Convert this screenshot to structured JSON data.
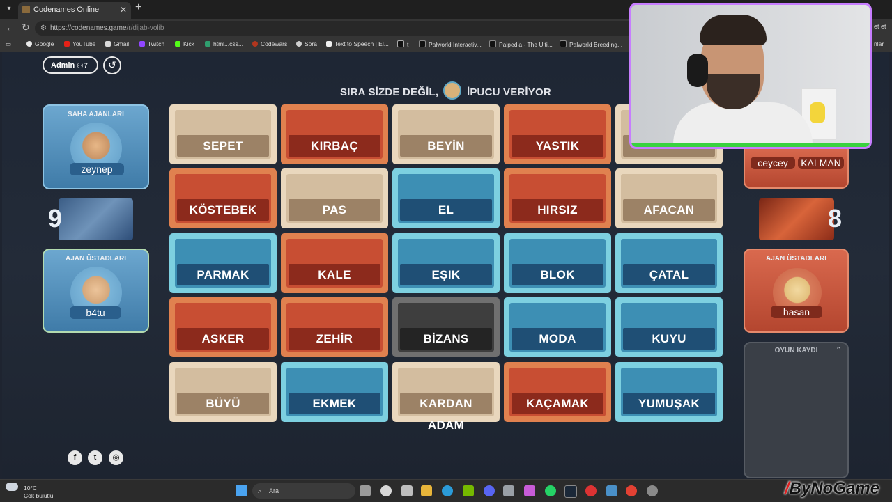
{
  "browser": {
    "tab_title": "Codenames Online",
    "url_prefix": "https://codenames.game",
    "url_path": "/r/dijab-volib",
    "addr_right": "et et",
    "bookmarks": [
      "Google",
      "YouTube",
      "Gmail",
      "Twitch",
      "Kick",
      "html...css...",
      "Codewars",
      "Sora",
      "Text to Speech | El...",
      "t",
      "Palworld Interactiv...",
      "Palpedia - The Ulti...",
      "Palworld Breeding..."
    ],
    "bookmarks_right": "nlar"
  },
  "game": {
    "admin_label": "Admin",
    "player_count": "7",
    "status_prefix": "SIRA SİZDE DEĞİL,",
    "status_suffix": "İPUCU VERİYOR",
    "blue": {
      "operatives_title": "SAHA AJANLARI",
      "operative_name": "zeynep",
      "score": "9",
      "spymasters_title": "AJAN ÜSTADLARI",
      "spymaster_name": "b4tu"
    },
    "red": {
      "operative_names": [
        "ceycey",
        "KALMAN"
      ],
      "score": "8",
      "spymasters_title": "AJAN ÜSTADLARI",
      "spymaster_name": "hasan"
    },
    "log_title": "OYUN KAYDI",
    "cards": [
      [
        "SEPET",
        "KIRBAÇ",
        "BEYİN",
        "YASTIK",
        ""
      ],
      [
        "KÖSTEBEK",
        "PAS",
        "EL",
        "HIRSIZ",
        "AFACAN"
      ],
      [
        "PARMAK",
        "KALE",
        "EŞIK",
        "BLOK",
        "ÇATAL"
      ],
      [
        "ASKER",
        "ZEHİR",
        "BİZANS",
        "MODA",
        "KUYU"
      ],
      [
        "BÜYÜ",
        "EKMEK",
        "KARDAN ADAM",
        "KAÇAMAK",
        "YUMUŞAK"
      ]
    ],
    "card_colors": [
      [
        "neutral",
        "red",
        "neutral",
        "red",
        "neutral"
      ],
      [
        "red",
        "neutral",
        "blue",
        "red",
        "neutral"
      ],
      [
        "blue",
        "red",
        "blue",
        "blue",
        "blue"
      ],
      [
        "red",
        "red",
        "assassin",
        "blue",
        "blue"
      ],
      [
        "neutral",
        "blue",
        "neutral",
        "red",
        "blue"
      ]
    ]
  },
  "taskbar": {
    "temp": "10°C",
    "weather": "Çok bulutlu",
    "search_placeholder": "Ara",
    "brand": "ByNoGame"
  }
}
